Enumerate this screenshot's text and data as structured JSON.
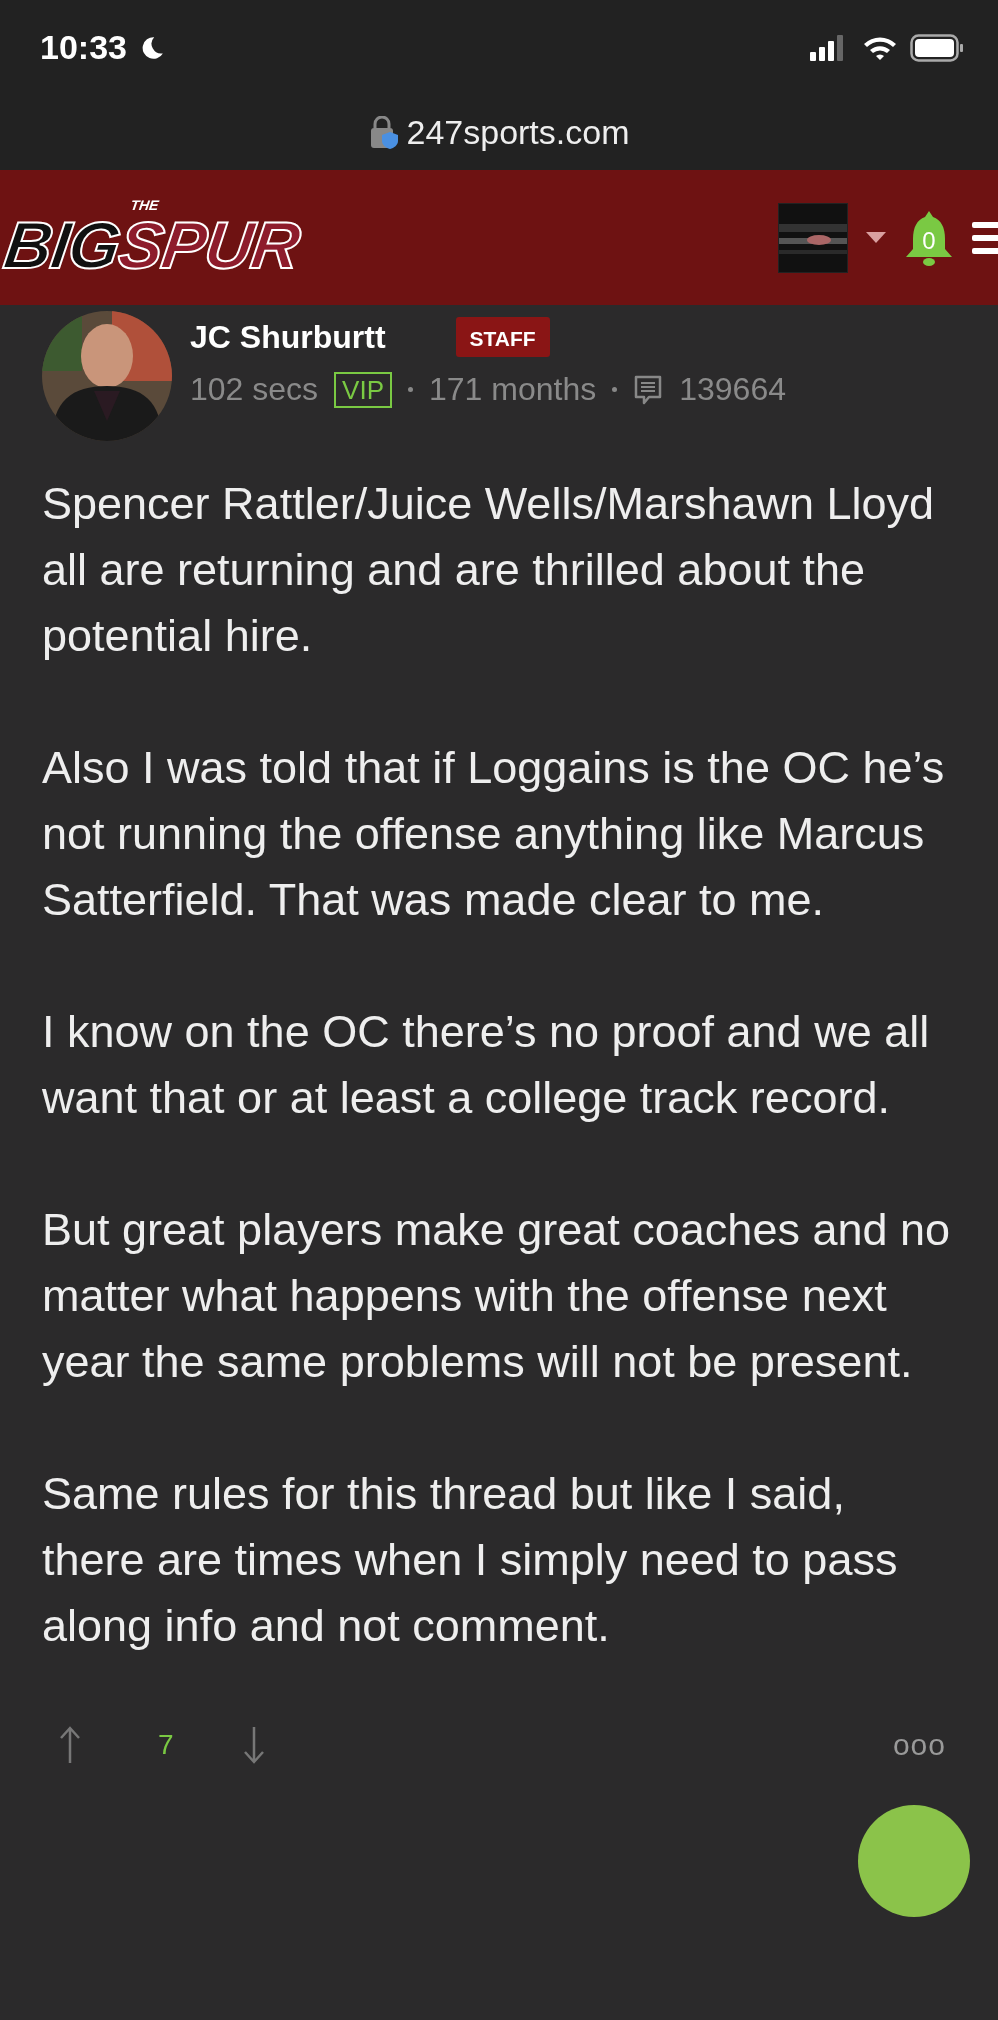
{
  "status_bar": {
    "time": "10:33"
  },
  "browser": {
    "url": "247sports.com"
  },
  "header": {
    "logo_top": "THE",
    "logo_left": "BIG",
    "logo_right": "SPUR",
    "notification_count": "0"
  },
  "post": {
    "author": "JC Shurburtt",
    "role_badge": "STAFF",
    "time_ago": "102 secs",
    "membership_badge": "VIP",
    "tenure": "171 months",
    "post_count": "139664",
    "paragraphs": [
      "Spencer Rattler/Juice Wells/Marshawn Lloyd all are returning and are thrilled about the potential hire.",
      "Also I was told that if Loggains is the OC he’s not running the offense anything like Marcus Satterfield. That was made clear to me.",
      "I know on the OC there’s no proof and we all want that or at least a college track record.",
      "But great players make great coaches and no matter what happens with the offense next year the same problems will not be present.",
      "Same rules for this thread but like I said, there are times when I simply need to pass along info and not comment."
    ],
    "vote_count": "7",
    "more_options": "ooo"
  }
}
